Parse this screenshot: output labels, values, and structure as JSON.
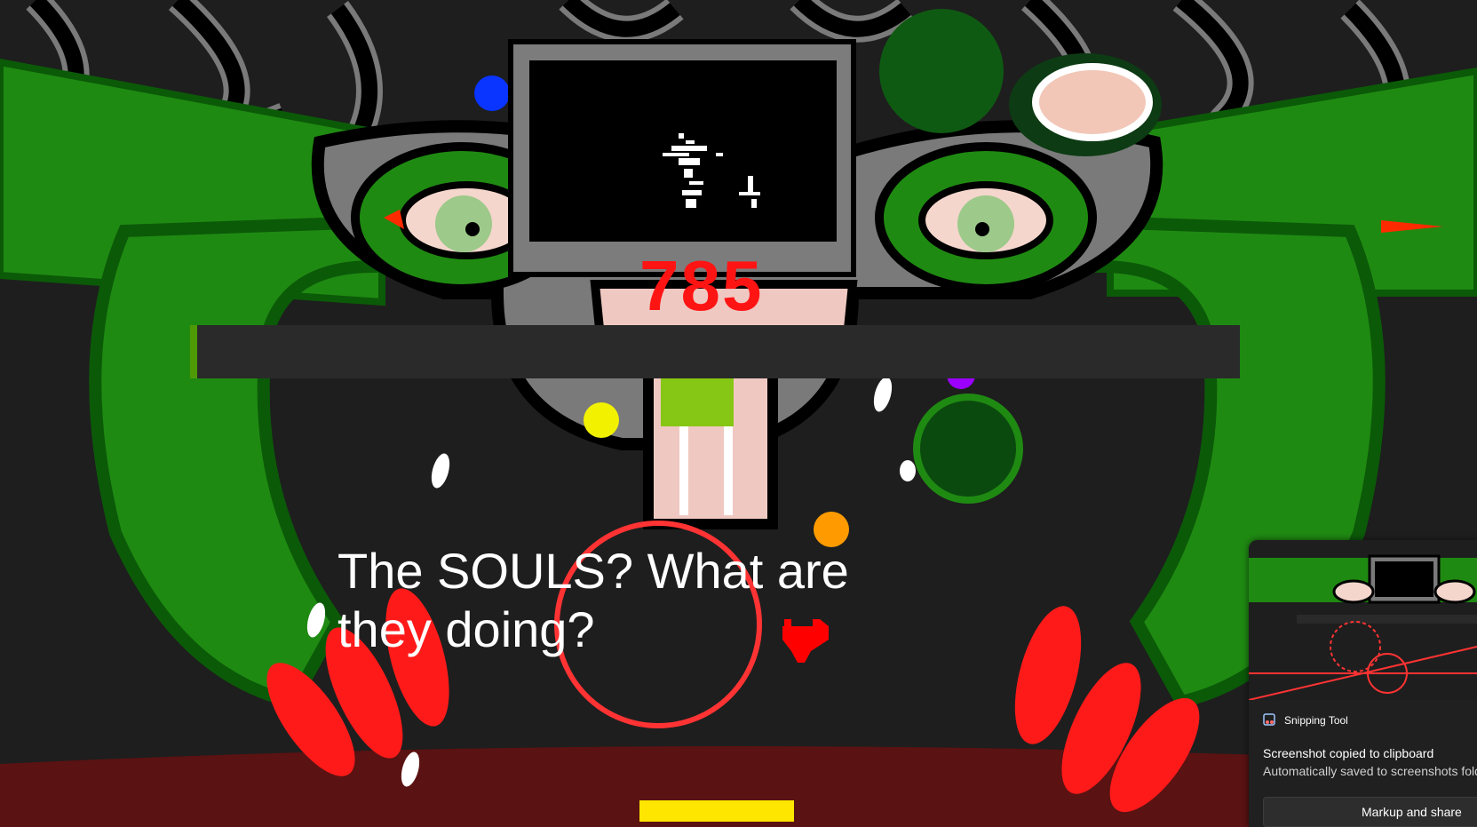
{
  "game": {
    "score": "785",
    "dialog_line1": "The SOULS? What are",
    "dialog_line2": "they doing?",
    "health_fraction": 0.006
  },
  "colors": {
    "background": "#1e1e1e",
    "monster_green": "#1f8a12",
    "score_red": "#ff1414",
    "soul_red": "#ff0000",
    "floor_red": "#5a1212",
    "ring_red": "#ff3333"
  },
  "orbs": [
    "blue",
    "yellow",
    "orange",
    "purple"
  ],
  "toast": {
    "app_name": "Snipping Tool",
    "title": "Screenshot copied to clipboard",
    "subtitle": "Automatically saved to screenshots folder",
    "button_label": "Markup and share"
  }
}
